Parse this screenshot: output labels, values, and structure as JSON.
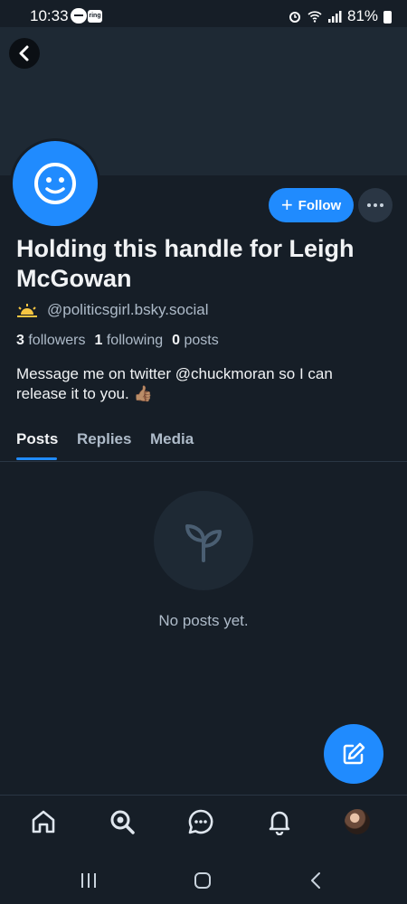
{
  "status_bar": {
    "time": "10:33",
    "ring_label": "ring",
    "battery": "81%"
  },
  "profile": {
    "display_name": "Holding this handle for Leigh McGowan",
    "handle": "@politicsgirl.bsky.social",
    "followers_count": "3",
    "followers_label": "followers",
    "following_count": "1",
    "following_label": "following",
    "posts_count": "0",
    "posts_label": "posts",
    "bio": "Message me on twitter @chuckmoran so I can release it to you. 👍🏽"
  },
  "actions": {
    "follow_label": "Follow"
  },
  "tabs": [
    {
      "label": "Posts",
      "active": true
    },
    {
      "label": "Replies",
      "active": false
    },
    {
      "label": "Media",
      "active": false
    }
  ],
  "empty_state": {
    "text": "No posts yet."
  },
  "nav_icons": [
    "home-icon",
    "search-icon",
    "chat-icon",
    "bell-icon",
    "profile-avatar"
  ],
  "colors": {
    "accent": "#208bfe",
    "background": "#161e27",
    "banner": "#1e2934",
    "muted_text": "#aebbc9"
  }
}
